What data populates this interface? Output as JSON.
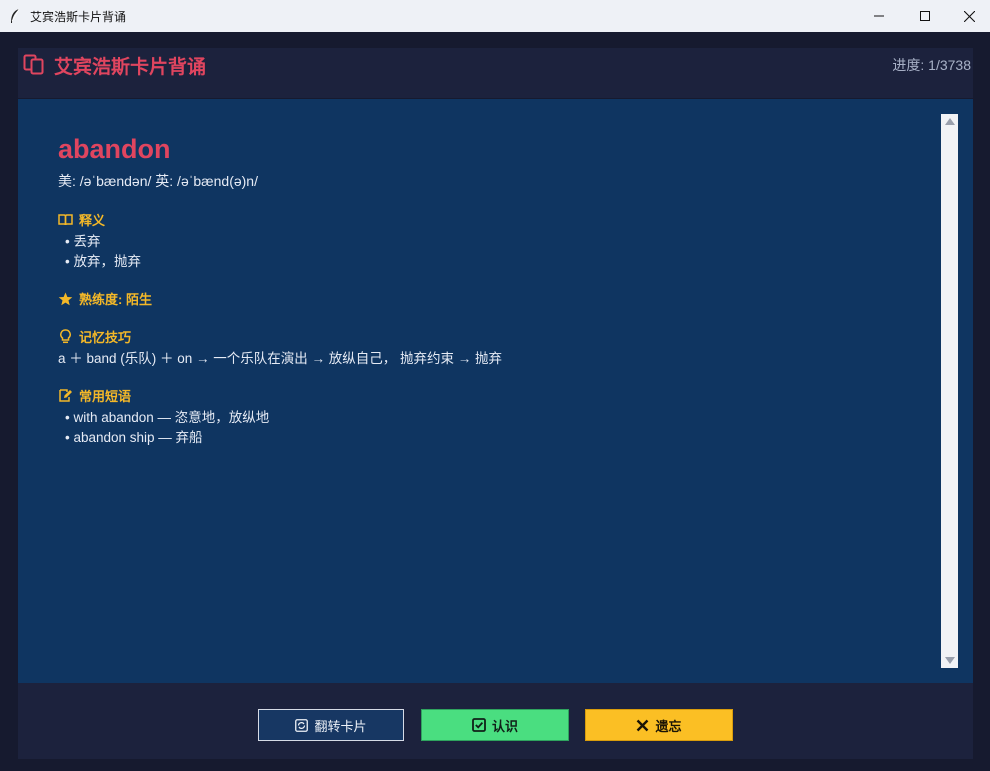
{
  "window": {
    "title": "艾宾浩斯卡片背诵"
  },
  "header": {
    "app_name": "艾宾浩斯卡片背诵",
    "progress": "进度: 1/3738"
  },
  "card": {
    "word": "abandon",
    "phonetic": "美: /əˈbændən/  英: /əˈbænd(ə)n/",
    "definition_title": "释义",
    "definitions": [
      "• 丢弃",
      "• 放弃，抛弃"
    ],
    "proficiency": "熟练度: 陌生",
    "memory_title": "记忆技巧",
    "memory_tip": "a ＋ band (乐队) ＋ on → 一个乐队在演出 → 放纵自己， 抛弃约束 → 抛弃",
    "phrases_title": "常用短语",
    "phrases": [
      "• with abandon — 恣意地，放纵地",
      "• abandon ship — 弃船"
    ]
  },
  "buttons": {
    "flip": "翻转卡片",
    "know": "认识",
    "forgot": "遗忘"
  },
  "colors": {
    "accent": "#e0455f",
    "section": "#f4b828",
    "card_bg": "#0f3561",
    "know": "#4ade80",
    "forgot": "#fbbf24"
  },
  "icons": {
    "app": "feather-icon",
    "logo": "cards-icon",
    "definition": "book-icon",
    "proficiency": "star-icon",
    "memory": "lightbulb-icon",
    "phrases": "edit-icon",
    "flip": "rotate-icon",
    "know": "check-square-icon",
    "forgot": "x-icon"
  }
}
